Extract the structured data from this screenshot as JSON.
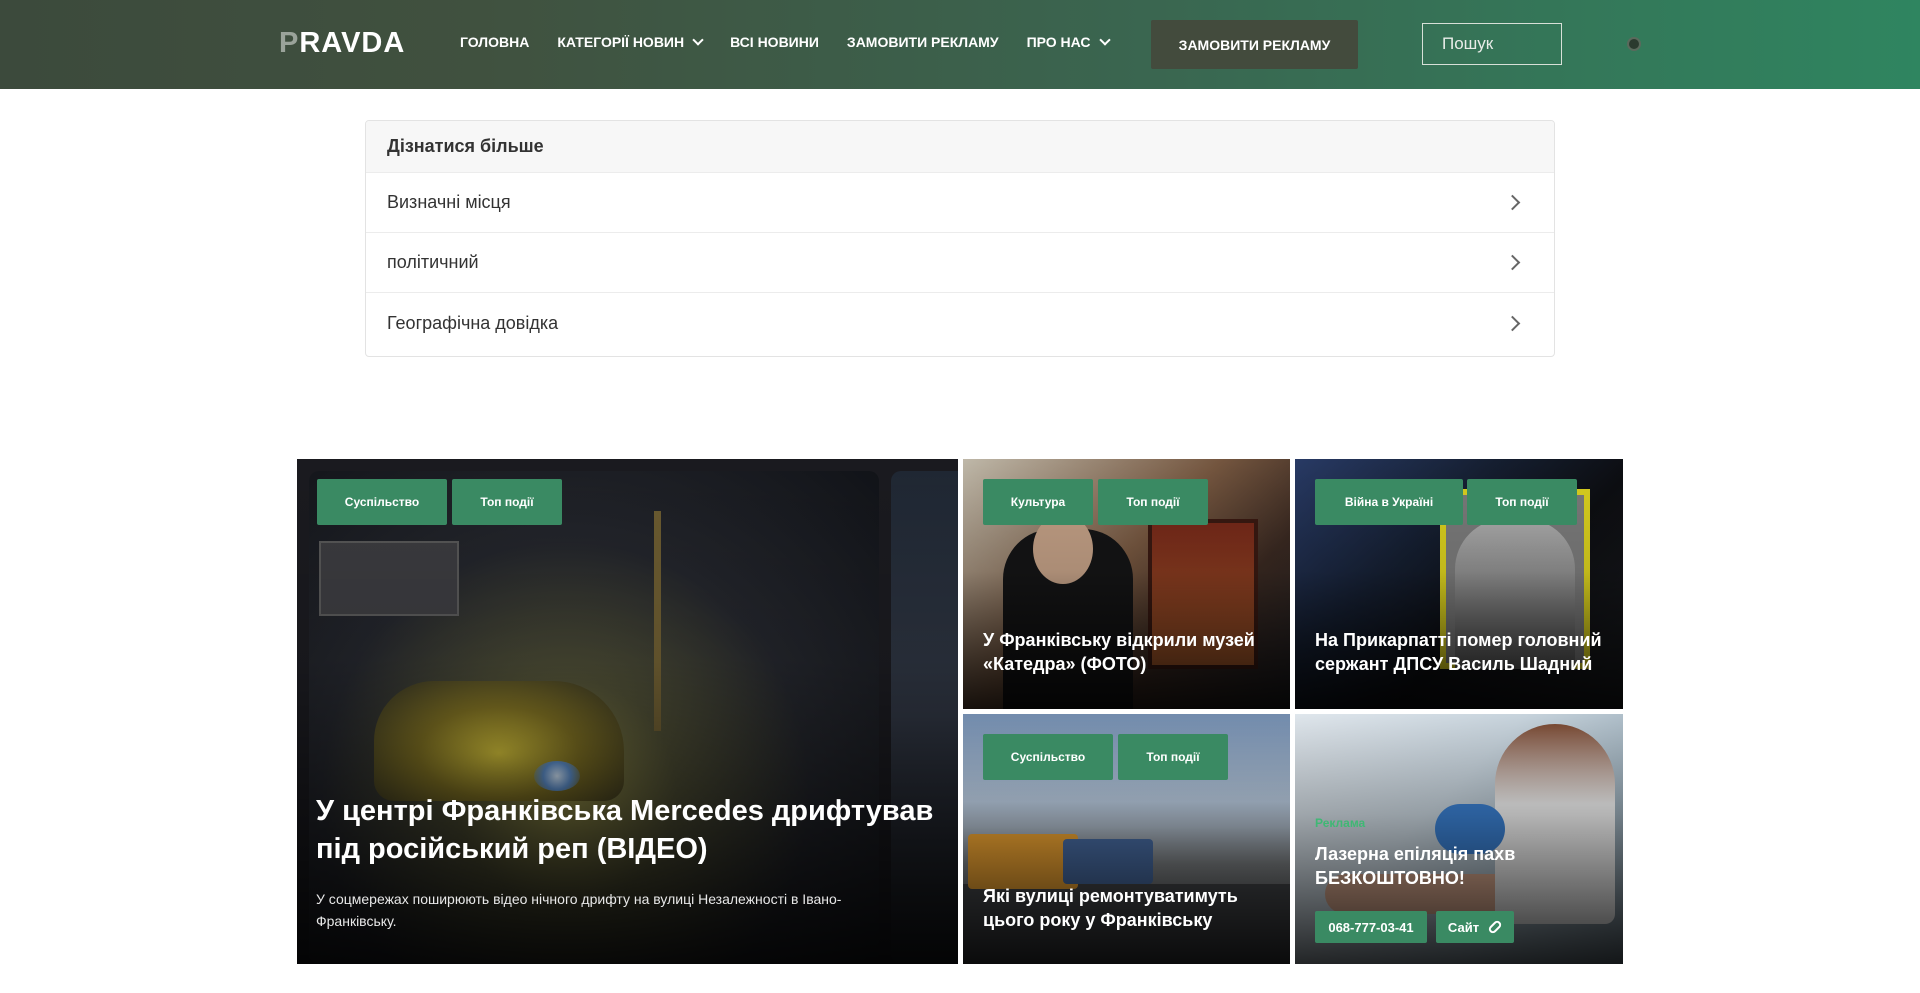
{
  "header": {
    "logo_first": "P",
    "logo_rest": "RAVDA",
    "nav": [
      {
        "label": "ГОЛОВНА"
      },
      {
        "label": "КАТЕГОРІЇ НОВИН"
      },
      {
        "label": "ВСІ НОВИНИ"
      },
      {
        "label": "ЗАМОВИТИ РЕКЛАМУ"
      },
      {
        "label": "ПРО НАС"
      }
    ],
    "cta_label": "ЗАМОВИТИ РЕКЛАМУ",
    "search_placeholder": "Пошук"
  },
  "accordion": {
    "title": "Дізнатися більше",
    "items": [
      {
        "label": "Визначні місця"
      },
      {
        "label": "політичний"
      },
      {
        "label": "Географічна довідка"
      }
    ]
  },
  "cards": {
    "main": {
      "tags": [
        "Суспільство",
        "Топ події"
      ],
      "title": "У центрі Франківська Mercedes дрифтував під російський реп (ВІДЕО)",
      "excerpt": "У соцмережах поширюють відео нічного дрифту на вулиці Незалежності в Івано-Франківську."
    },
    "museum": {
      "tags": [
        "Культура",
        "Топ події"
      ],
      "title": "У Франківську відкрили музей «Катедра» (ФОТО)"
    },
    "war": {
      "tags": [
        "Війна в Україні",
        "Топ події"
      ],
      "title": "На Прикарпатті помер головний сержант ДПСУ Василь Шадний"
    },
    "streets": {
      "tags": [
        "Суспільство",
        "Топ події"
      ],
      "title": "Які вулиці ремонтуватимуть цього року у Франківську"
    },
    "ad": {
      "label": "Реклама",
      "title": "Лазерна епіляція пахв БЕЗКОШТОВНО!",
      "phone": "068-777-03-41",
      "site": "Сайт"
    }
  },
  "colors": {
    "accent": "#3a8a63",
    "header_dark": "#3c4a3c",
    "header_green": "#2f8560",
    "cta": "#434b3d"
  }
}
